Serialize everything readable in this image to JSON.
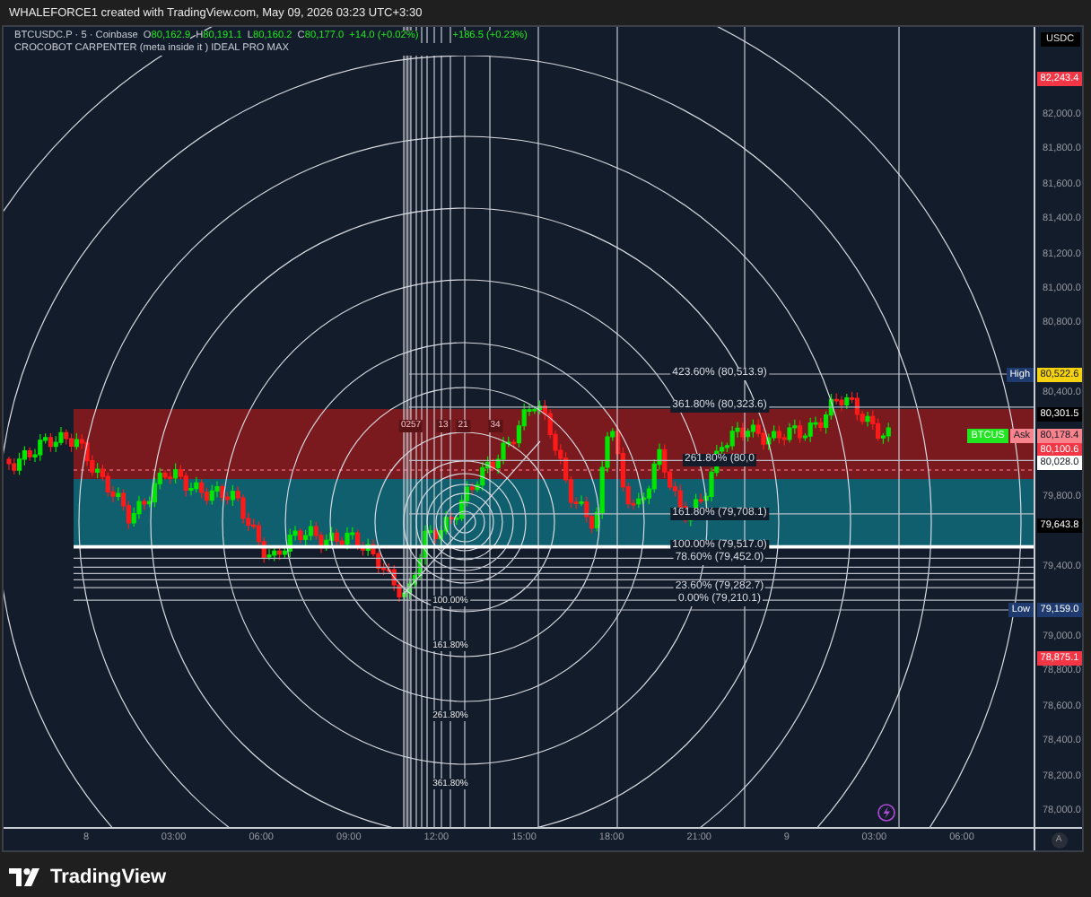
{
  "header": {
    "title": "WHALEFORCE1 created with TradingView.com, May 09, 2026 03:23 UTC+3:30"
  },
  "legend": {
    "symbol": "BTCUSDC.P · 5 · Coinbase",
    "ohlc": [
      {
        "label": "O",
        "value": "80,162.9"
      },
      {
        "label": "H",
        "value": "80,191.1"
      },
      {
        "label": "L",
        "value": "80,160.2"
      },
      {
        "label": "C",
        "value": "80,177.0"
      }
    ],
    "change": "+14.0 (+0.02%)",
    "change_2": "+186.5 (+0.23%)",
    "indicator": "CROCOBOT CARPENTER (meta inside it ) IDEAL PRO MAX"
  },
  "currency": "USDC",
  "price_axis": [
    "82,000.0",
    "81,800.0",
    "81,600.0",
    "81,400.0",
    "81,200.0",
    "81,000.0",
    "80,800.0",
    "80,400.0",
    "79,800.0",
    "79,400.0",
    "79,000.0",
    "78,800.0",
    "78,600.0",
    "78,400.0",
    "78,200.0",
    "78,000.0"
  ],
  "price_tags": [
    {
      "text": "82,243.4",
      "color": "#f23645"
    },
    {
      "text": "80,522.6",
      "color": "#f5d20f",
      "side": [
        {
          "text": "High",
          "color": "#1e3a6e"
        }
      ]
    },
    {
      "text": "80,301.5",
      "color": "#000000"
    },
    {
      "text": "80,178.4",
      "color": "#f7838c",
      "side": [
        {
          "text": "BTCUS",
          "color": "#22e622"
        },
        {
          "text": "Ask",
          "color": "#f7838c"
        }
      ]
    },
    {
      "text": "80,100.6",
      "color": "#f23645"
    },
    {
      "text": "80,028.0",
      "color": "#ffffff"
    },
    {
      "text": "79,643.8",
      "color": "#000000"
    },
    {
      "text": "79,159.0",
      "color": "#1e3a6e",
      "side": [
        {
          "text": "Low",
          "color": "#1e3a6e"
        }
      ]
    },
    {
      "text": "78,875.1",
      "color": "#f23645"
    }
  ],
  "fib_levels": [
    "423.60% (80,513.9)",
    "361.80% (80,323.6)",
    "261.80% (80,0",
    "161.80% (79,708.1)",
    "100.00% (79,517.0)",
    "78.60% (79,452.0)",
    "23.60% (79,282.7)",
    "0.00% (79,210.1)"
  ],
  "fib_circle_labels": [
    "100.00%",
    "161.80%",
    "261.80%",
    "361.80%"
  ],
  "time_zones": [
    "0257",
    "13",
    "21",
    "34"
  ],
  "time_axis": [
    "8",
    "03:00",
    "06:00",
    "09:00",
    "12:00",
    "15:00",
    "18:00",
    "21:00",
    "9",
    "03:00",
    "06:00"
  ],
  "scale_button": "A",
  "footer": {
    "brand": "TradingView"
  }
}
